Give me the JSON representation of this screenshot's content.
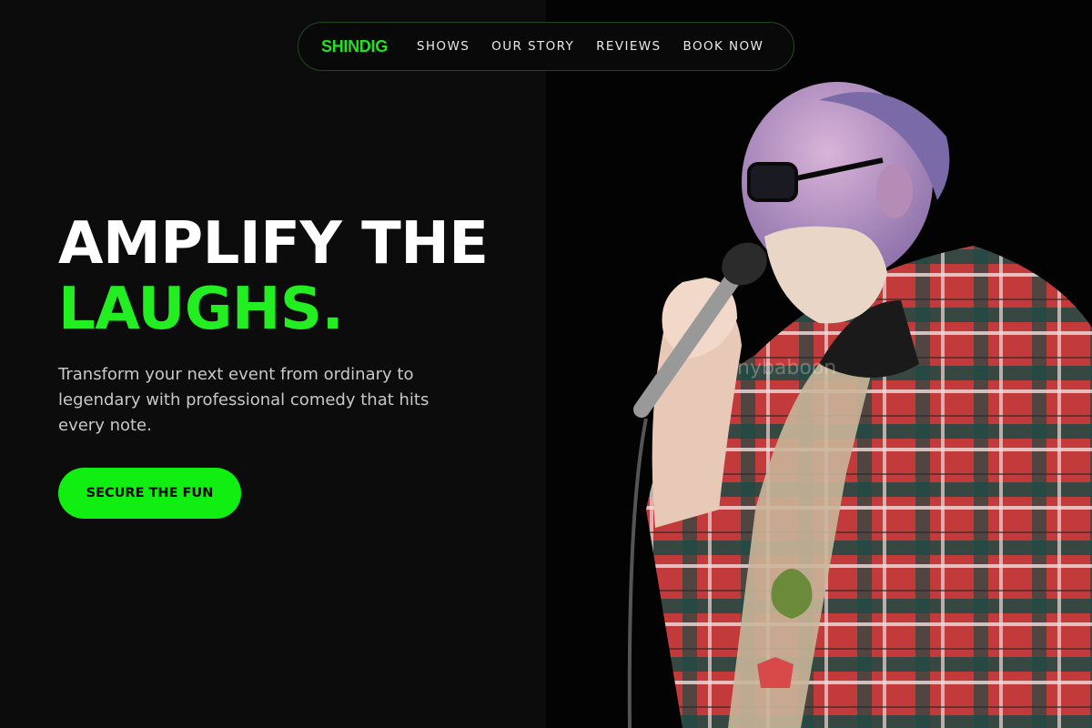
{
  "nav": {
    "brand": "SHINDIG",
    "links": [
      "SHOWS",
      "OUR STORY",
      "REVIEWS",
      "BOOK NOW"
    ]
  },
  "hero": {
    "title_line1": "AMPLIFY THE",
    "title_line2": "LAUGHS.",
    "subtitle": "Transform your next event from ordinary to legendary with professional comedy that hits every note.",
    "cta_label": "SECURE THE FUN"
  },
  "photo": {
    "subject": "comedian-with-microphone",
    "watermark": "nybaboon"
  },
  "colors": {
    "accent": "#22ee22",
    "background": "#0c0c0c",
    "text": "#ffffff"
  }
}
